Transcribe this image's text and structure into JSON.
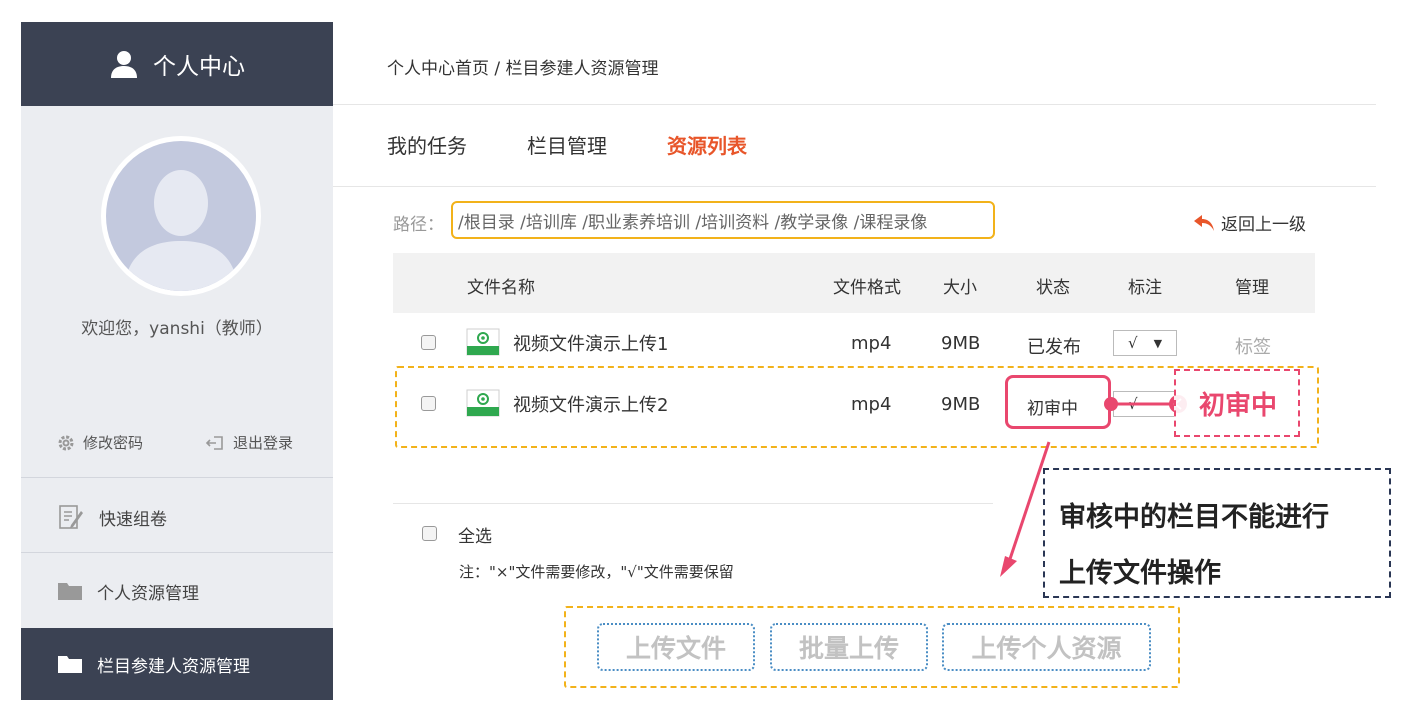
{
  "sidebar": {
    "header_title": "个人中心",
    "welcome": "欢迎您，yanshi（教师）",
    "change_password": "修改密码",
    "logout": "退出登录",
    "items": [
      {
        "label": "快速组卷"
      },
      {
        "label": "个人资源管理"
      },
      {
        "label": "栏目参建人资源管理"
      }
    ]
  },
  "breadcrumb": "个人中心首页 / 栏目参建人资源管理",
  "tabs": [
    {
      "label": "我的任务"
    },
    {
      "label": "栏目管理"
    },
    {
      "label": "资源列表"
    }
  ],
  "path": {
    "label": "路径：",
    "value": "/根目录 /培训库 /职业素养培训 /培训资料 /教学录像 /课程录像"
  },
  "back_label": "返回上一级",
  "table": {
    "headers": [
      "文件名称",
      "文件格式",
      "大小",
      "状态",
      "标注",
      "管理"
    ],
    "rows": [
      {
        "name": "视频文件演示上传1",
        "format": "mp4",
        "size": "9MB",
        "status": "已发布",
        "mark": "√",
        "manage": "标签"
      },
      {
        "name": "视频文件演示上传2",
        "format": "mp4",
        "size": "9MB",
        "status": "初审中",
        "mark": "√",
        "manage": ""
      }
    ]
  },
  "select_all": "全选",
  "note": "注：\"×\"文件需要修改，\"√\"文件需要保留",
  "buttons": {
    "upload_file": "上传文件",
    "batch_upload": "批量上传",
    "upload_personal": "上传个人资源"
  },
  "annotation": {
    "callout": "初审中",
    "note_line1": "审核中的栏目不能进行",
    "note_line2": "上传文件操作"
  },
  "colors": {
    "sidebar_dark": "#3b4253",
    "active_tab": "#e8562a",
    "highlight_yellow": "#f2b21a",
    "annotation_pink": "#e9476e",
    "note_border": "#2a3654"
  }
}
